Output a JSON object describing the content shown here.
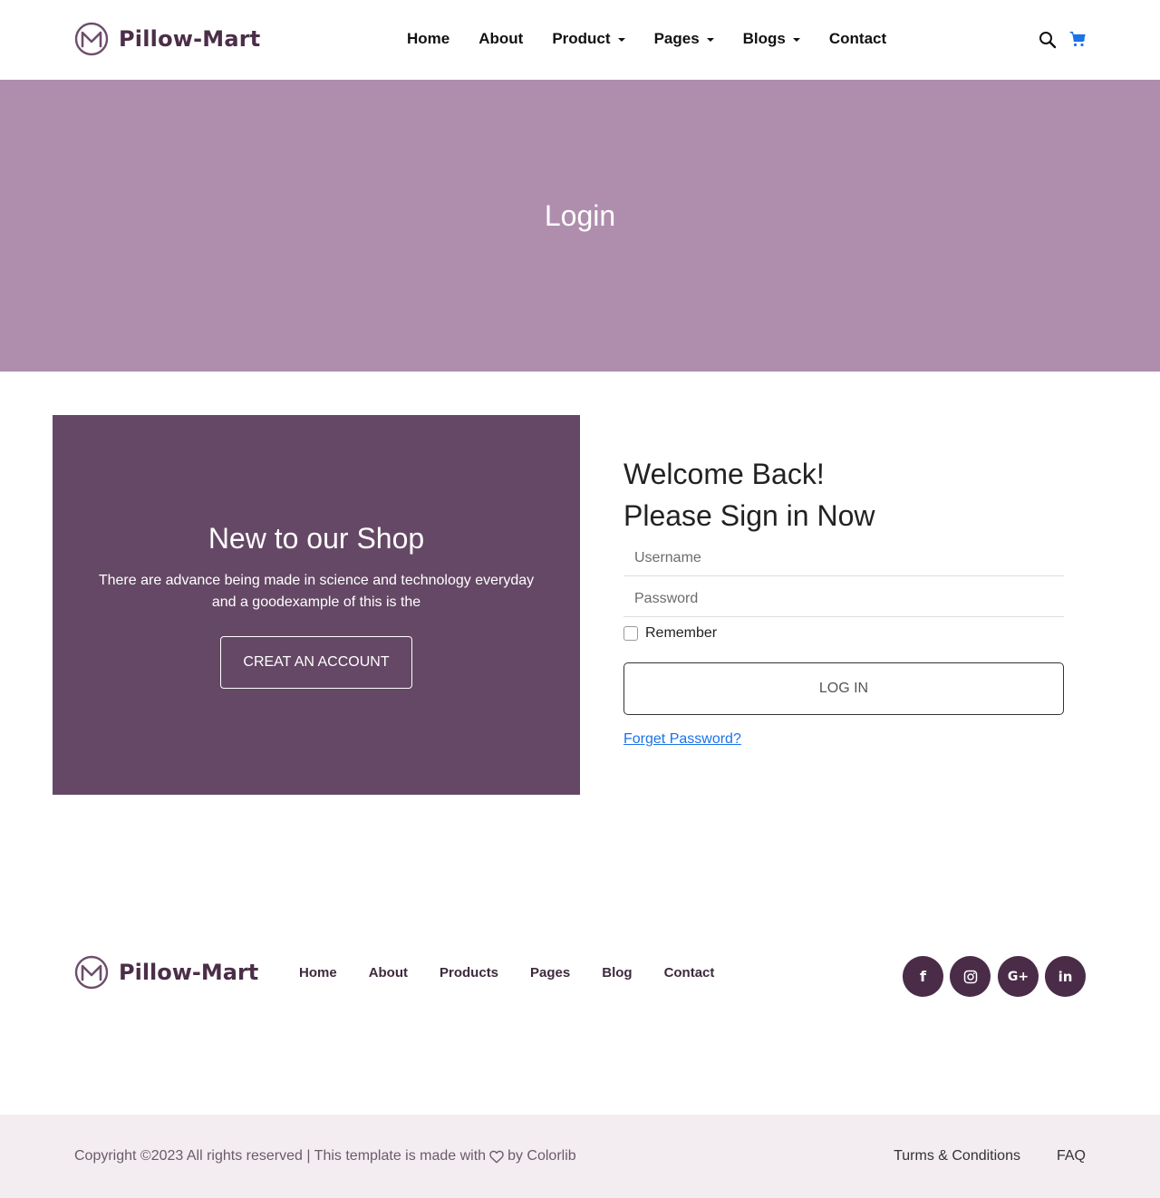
{
  "header": {
    "brand": "Pillow-Mart",
    "nav": [
      {
        "label": "Home",
        "dropdown": false
      },
      {
        "label": "About",
        "dropdown": false
      },
      {
        "label": "Product",
        "dropdown": true
      },
      {
        "label": "Pages",
        "dropdown": true
      },
      {
        "label": "Blogs",
        "dropdown": true
      },
      {
        "label": "Contact",
        "dropdown": false
      }
    ],
    "icons": [
      "search-icon",
      "cart-icon"
    ]
  },
  "banner": {
    "title": "Login"
  },
  "promo": {
    "title": "New to our Shop",
    "text": "There are advance being made in science and technology everyday and a goodexample of this is the",
    "button": "CREAT AN ACCOUNT"
  },
  "login": {
    "heading_line1": "Welcome Back!",
    "heading_line2": "Please Sign in Now",
    "username_placeholder": "Username",
    "password_placeholder": "Password",
    "remember_label": "Remember",
    "remember_checked": false,
    "submit_label": "LOG IN",
    "forgot_label": "Forget Password?"
  },
  "footer": {
    "brand": "Pillow-Mart",
    "nav": [
      "Home",
      "About",
      "Products",
      "Pages",
      "Blog",
      "Contact"
    ],
    "social": [
      "facebook-icon",
      "instagram-icon",
      "google-plus-icon",
      "linkedin-icon"
    ],
    "copyright_prefix": "Copyright ©2023 All rights reserved | This template is made with",
    "copyright_suffix": "by Colorlib",
    "links": [
      "Turms & Conditions",
      "FAQ"
    ]
  },
  "colors": {
    "brand": "#4b2e48",
    "banner": "#af8ead",
    "promo": "#654865",
    "social": "#4a2c48",
    "link": "#1a73e8",
    "cart": "#1a73e8",
    "bottom_bar": "#f3edf1"
  }
}
